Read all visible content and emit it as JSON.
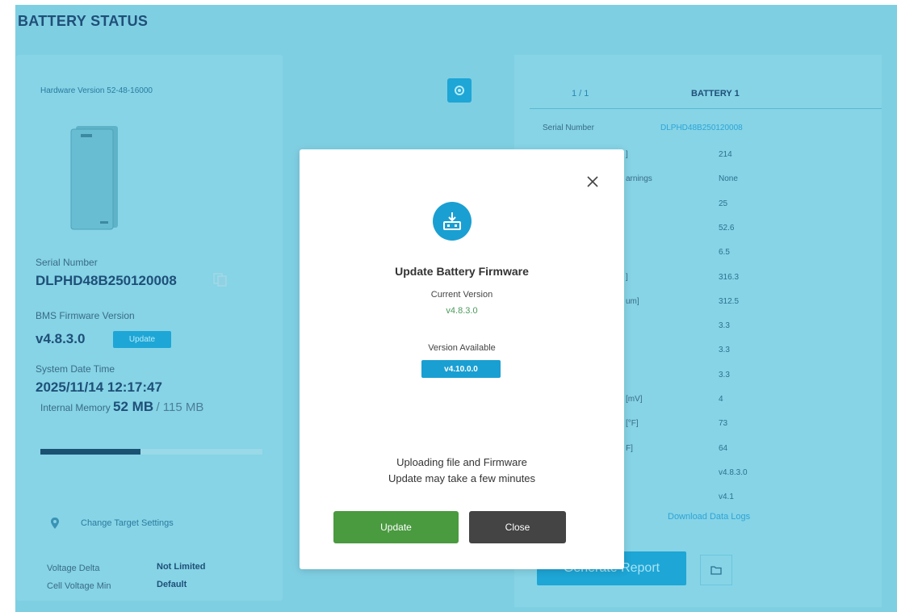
{
  "page_title": "BATTERY STATUS",
  "left": {
    "hardware_version": "Hardware Version 52-48-16000",
    "serial_label": "Serial Number",
    "serial_value": "DLPHD48B250120008",
    "bms_label": "BMS Firmware Version",
    "bms_value": "v4.8.3.0",
    "bms_update_label": "Update",
    "datetime_label": "System Date Time",
    "datetime_value": "2025/11/14 12:17:47",
    "memory_label": "Internal Memory",
    "memory_used": "52 MB",
    "memory_total": "/ 115 MB",
    "memory_fraction": 0.45,
    "charge_settings_label": "Change Target Settings",
    "voltage_delta_label": "Voltage Delta",
    "voltage_delta_value": "Not Limited",
    "cell_voltage_min_label": "Cell Voltage Min",
    "cell_voltage_min_value": "Default"
  },
  "right": {
    "tab_page": "1 / 1",
    "tab_battery": "BATTERY 1",
    "serial_label": "Serial Number",
    "serial_value": "DLPHD48B250120008",
    "rows": [
      {
        "label": "]",
        "value": "214"
      },
      {
        "label": "arnings",
        "value": "None"
      },
      {
        "label": "",
        "value": "25"
      },
      {
        "label": "",
        "value": "52.6"
      },
      {
        "label": "",
        "value": "6.5"
      },
      {
        "label": "]",
        "value": "316.3"
      },
      {
        "label": "um]",
        "value": "312.5"
      },
      {
        "label": "",
        "value": "3.3"
      },
      {
        "label": "",
        "value": "3.3"
      },
      {
        "label": "",
        "value": "3.3"
      },
      {
        "label": "[mV]",
        "value": "4"
      },
      {
        "label": "[°F]",
        "value": "73"
      },
      {
        "label": "F]",
        "value": "64"
      },
      {
        "label": "",
        "value": "v4.8.3.0"
      },
      {
        "label": "",
        "value": "v4.1"
      }
    ],
    "download_logs": "Download Data Logs",
    "generate_report": "Generate Report"
  },
  "modal": {
    "title": "Update Battery Firmware",
    "current_label": "Current Version",
    "current_value": "v4.8.3.0",
    "available_label": "Version Available",
    "available_value": "v4.10.0.0",
    "message_line1": "Uploading file and Firmware",
    "message_line2": "Update may take a few minutes",
    "update_button": "Update",
    "close_button": "Close"
  },
  "colors": {
    "overlay_bg": "#7fcfe3",
    "accent": "#1ea6d6",
    "update_green": "#4a9a40",
    "close_gray": "#444444"
  }
}
